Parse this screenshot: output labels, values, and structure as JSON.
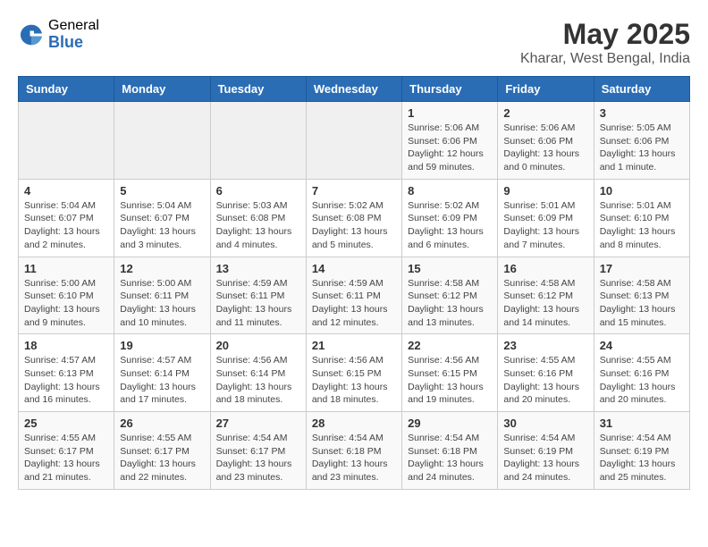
{
  "header": {
    "logo_general": "General",
    "logo_blue": "Blue",
    "title": "May 2025",
    "subtitle": "Kharar, West Bengal, India"
  },
  "days_of_week": [
    "Sunday",
    "Monday",
    "Tuesday",
    "Wednesday",
    "Thursday",
    "Friday",
    "Saturday"
  ],
  "weeks": [
    [
      {
        "day": "",
        "info": ""
      },
      {
        "day": "",
        "info": ""
      },
      {
        "day": "",
        "info": ""
      },
      {
        "day": "",
        "info": ""
      },
      {
        "day": "1",
        "info": "Sunrise: 5:06 AM\nSunset: 6:06 PM\nDaylight: 12 hours and 59 minutes."
      },
      {
        "day": "2",
        "info": "Sunrise: 5:06 AM\nSunset: 6:06 PM\nDaylight: 13 hours and 0 minutes."
      },
      {
        "day": "3",
        "info": "Sunrise: 5:05 AM\nSunset: 6:06 PM\nDaylight: 13 hours and 1 minute."
      }
    ],
    [
      {
        "day": "4",
        "info": "Sunrise: 5:04 AM\nSunset: 6:07 PM\nDaylight: 13 hours and 2 minutes."
      },
      {
        "day": "5",
        "info": "Sunrise: 5:04 AM\nSunset: 6:07 PM\nDaylight: 13 hours and 3 minutes."
      },
      {
        "day": "6",
        "info": "Sunrise: 5:03 AM\nSunset: 6:08 PM\nDaylight: 13 hours and 4 minutes."
      },
      {
        "day": "7",
        "info": "Sunrise: 5:02 AM\nSunset: 6:08 PM\nDaylight: 13 hours and 5 minutes."
      },
      {
        "day": "8",
        "info": "Sunrise: 5:02 AM\nSunset: 6:09 PM\nDaylight: 13 hours and 6 minutes."
      },
      {
        "day": "9",
        "info": "Sunrise: 5:01 AM\nSunset: 6:09 PM\nDaylight: 13 hours and 7 minutes."
      },
      {
        "day": "10",
        "info": "Sunrise: 5:01 AM\nSunset: 6:10 PM\nDaylight: 13 hours and 8 minutes."
      }
    ],
    [
      {
        "day": "11",
        "info": "Sunrise: 5:00 AM\nSunset: 6:10 PM\nDaylight: 13 hours and 9 minutes."
      },
      {
        "day": "12",
        "info": "Sunrise: 5:00 AM\nSunset: 6:11 PM\nDaylight: 13 hours and 10 minutes."
      },
      {
        "day": "13",
        "info": "Sunrise: 4:59 AM\nSunset: 6:11 PM\nDaylight: 13 hours and 11 minutes."
      },
      {
        "day": "14",
        "info": "Sunrise: 4:59 AM\nSunset: 6:11 PM\nDaylight: 13 hours and 12 minutes."
      },
      {
        "day": "15",
        "info": "Sunrise: 4:58 AM\nSunset: 6:12 PM\nDaylight: 13 hours and 13 minutes."
      },
      {
        "day": "16",
        "info": "Sunrise: 4:58 AM\nSunset: 6:12 PM\nDaylight: 13 hours and 14 minutes."
      },
      {
        "day": "17",
        "info": "Sunrise: 4:58 AM\nSunset: 6:13 PM\nDaylight: 13 hours and 15 minutes."
      }
    ],
    [
      {
        "day": "18",
        "info": "Sunrise: 4:57 AM\nSunset: 6:13 PM\nDaylight: 13 hours and 16 minutes."
      },
      {
        "day": "19",
        "info": "Sunrise: 4:57 AM\nSunset: 6:14 PM\nDaylight: 13 hours and 17 minutes."
      },
      {
        "day": "20",
        "info": "Sunrise: 4:56 AM\nSunset: 6:14 PM\nDaylight: 13 hours and 18 minutes."
      },
      {
        "day": "21",
        "info": "Sunrise: 4:56 AM\nSunset: 6:15 PM\nDaylight: 13 hours and 18 minutes."
      },
      {
        "day": "22",
        "info": "Sunrise: 4:56 AM\nSunset: 6:15 PM\nDaylight: 13 hours and 19 minutes."
      },
      {
        "day": "23",
        "info": "Sunrise: 4:55 AM\nSunset: 6:16 PM\nDaylight: 13 hours and 20 minutes."
      },
      {
        "day": "24",
        "info": "Sunrise: 4:55 AM\nSunset: 6:16 PM\nDaylight: 13 hours and 20 minutes."
      }
    ],
    [
      {
        "day": "25",
        "info": "Sunrise: 4:55 AM\nSunset: 6:17 PM\nDaylight: 13 hours and 21 minutes."
      },
      {
        "day": "26",
        "info": "Sunrise: 4:55 AM\nSunset: 6:17 PM\nDaylight: 13 hours and 22 minutes."
      },
      {
        "day": "27",
        "info": "Sunrise: 4:54 AM\nSunset: 6:17 PM\nDaylight: 13 hours and 23 minutes."
      },
      {
        "day": "28",
        "info": "Sunrise: 4:54 AM\nSunset: 6:18 PM\nDaylight: 13 hours and 23 minutes."
      },
      {
        "day": "29",
        "info": "Sunrise: 4:54 AM\nSunset: 6:18 PM\nDaylight: 13 hours and 24 minutes."
      },
      {
        "day": "30",
        "info": "Sunrise: 4:54 AM\nSunset: 6:19 PM\nDaylight: 13 hours and 24 minutes."
      },
      {
        "day": "31",
        "info": "Sunrise: 4:54 AM\nSunset: 6:19 PM\nDaylight: 13 hours and 25 minutes."
      }
    ]
  ]
}
